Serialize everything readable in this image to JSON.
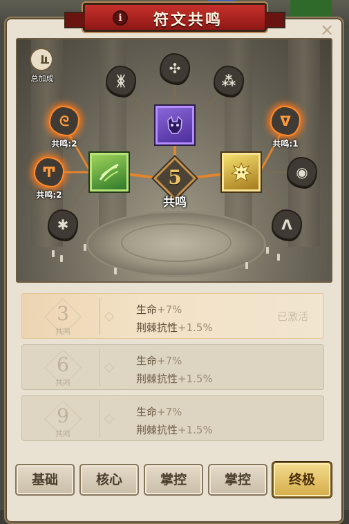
{
  "title": {
    "text": "符文共鸣",
    "info_icon": "i"
  },
  "close_icon": "×",
  "bonus": {
    "label": "总加成"
  },
  "center": {
    "level": "5",
    "label": "共鸣"
  },
  "runes": {
    "top_left": {
      "glyph": "ᛤ",
      "label": ""
    },
    "top_center": {
      "glyph": "✣",
      "label": ""
    },
    "top_right": {
      "glyph": "⁂",
      "label": ""
    },
    "mid_left": {
      "glyph": "ᘓ",
      "label": "共鸣:2"
    },
    "mid_right": {
      "glyph": "ᐁ",
      "label": "共鸣:1"
    },
    "lower_left": {
      "glyph": "Ͳ",
      "label": "共鸣:2"
    },
    "lower_right": {
      "glyph": "◉",
      "label": ""
    },
    "bottom_left": {
      "glyph": "✱",
      "label": ""
    },
    "bottom_right": {
      "glyph": "ᐱ",
      "label": ""
    }
  },
  "tiers": [
    {
      "level": "3",
      "sub": "共鸣",
      "stat1_name": "生命",
      "stat1_val": "+7%",
      "stat2_name": "荆棘抗性",
      "stat2_val": "+1.5%",
      "status": "已激活"
    },
    {
      "level": "6",
      "sub": "共鸣",
      "stat1_name": "生命",
      "stat1_val": "+7%",
      "stat2_name": "荆棘抗性",
      "stat2_val": "+1.5%",
      "status": ""
    },
    {
      "level": "9",
      "sub": "共鸣",
      "stat1_name": "生命",
      "stat1_val": "+7%",
      "stat2_name": "荆棘抗性",
      "stat2_val": "+1.5%",
      "status": ""
    }
  ],
  "tabs": [
    {
      "label": "基础"
    },
    {
      "label": "核心"
    },
    {
      "label": "掌控"
    },
    {
      "label": "掌控"
    },
    {
      "label": "终极"
    }
  ],
  "colors": {
    "accent_gold": "#d5ac4a",
    "title_red": "#c7312b",
    "active_glow": "#ff7a1a"
  }
}
